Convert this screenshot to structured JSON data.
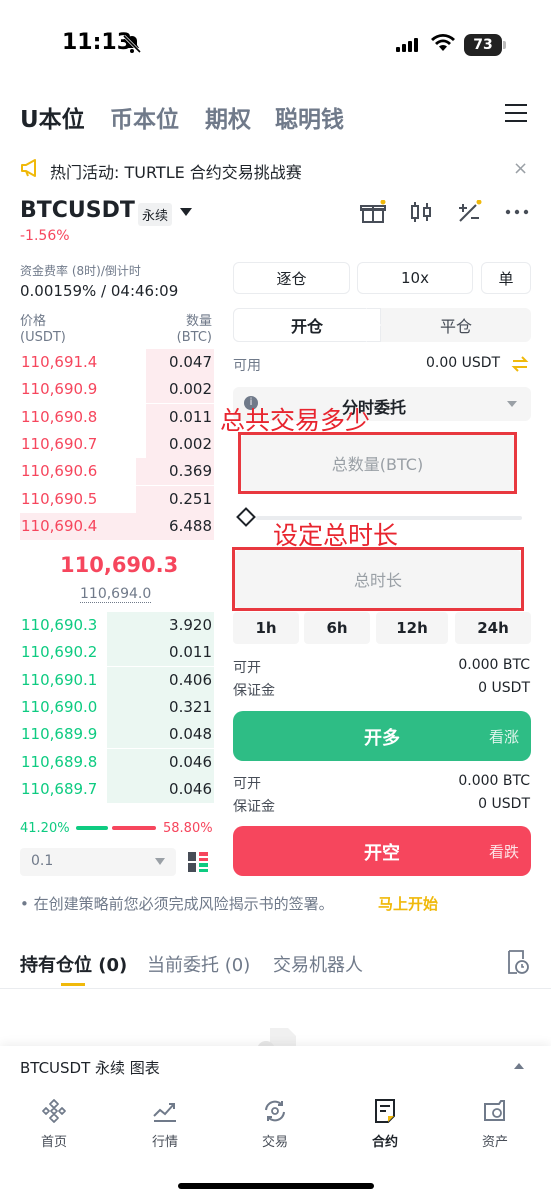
{
  "status_bar": {
    "time": "11:13",
    "battery": "73"
  },
  "top_tabs": [
    "U本位",
    "币本位",
    "期权",
    "聪明钱"
  ],
  "banner": {
    "text": "热门活动: TURTLE 合约交易挑战赛",
    "close": "×"
  },
  "symbol": {
    "name": "BTCUSDT",
    "tag": "永续",
    "change": "-1.56%"
  },
  "funding": {
    "label": "资金费率 (8时)/倒计时",
    "value": "0.00159% / 04:46:09"
  },
  "orderbook": {
    "price_header": "价格",
    "price_unit": "(USDT)",
    "qty_header": "数量",
    "qty_unit": "(BTC)",
    "asks": [
      {
        "price": "110,691.4",
        "qty": "0.047",
        "depth": 0.35
      },
      {
        "price": "110,690.9",
        "qty": "0.002",
        "depth": 0.35
      },
      {
        "price": "110,690.8",
        "qty": "0.011",
        "depth": 0.35
      },
      {
        "price": "110,690.7",
        "qty": "0.002",
        "depth": 0.35
      },
      {
        "price": "110,690.6",
        "qty": "0.369",
        "depth": 0.4
      },
      {
        "price": "110,690.5",
        "qty": "0.251",
        "depth": 0.4
      },
      {
        "price": "110,690.4",
        "qty": "6.488",
        "depth": 1.0
      }
    ],
    "last_price": "110,690.3",
    "mark_price": "110,694.0",
    "bids": [
      {
        "price": "110,690.3",
        "qty": "3.920",
        "depth": 0.55
      },
      {
        "price": "110,690.2",
        "qty": "0.011",
        "depth": 0.55
      },
      {
        "price": "110,690.1",
        "qty": "0.406",
        "depth": 0.55
      },
      {
        "price": "110,690.0",
        "qty": "0.321",
        "depth": 0.55
      },
      {
        "price": "110,689.9",
        "qty": "0.048",
        "depth": 0.55
      },
      {
        "price": "110,689.8",
        "qty": "0.046",
        "depth": 0.55
      },
      {
        "price": "110,689.7",
        "qty": "0.046",
        "depth": 0.55
      }
    ],
    "buy_ratio": "41.20%",
    "sell_ratio": "58.80%",
    "precision": "0.1"
  },
  "order_panel": {
    "margin_mode": "逐仓",
    "leverage": "10x",
    "position_mode": "单",
    "open_tab": "开仓",
    "close_tab": "平仓",
    "available_label": "可用",
    "available_value": "0.00 USDT",
    "order_type": "分时委托",
    "annotation_1": "总共交易多少",
    "quantity_placeholder": "总数量(BTC)",
    "annotation_2": "设定总时长",
    "duration_placeholder": "总时长",
    "durations": [
      "1h",
      "6h",
      "12h",
      "24h"
    ],
    "long_open_label": "可开",
    "long_open_value": "0.000 BTC",
    "long_margin_label": "保证金",
    "long_margin_value": "0 USDT",
    "long_button": "开多",
    "long_sub": "看涨",
    "short_open_label": "可开",
    "short_open_value": "0.000 BTC",
    "short_margin_label": "保证金",
    "short_margin_value": "0 USDT",
    "short_button": "开空",
    "short_sub": "看跌"
  },
  "notice": {
    "text": "•  在创建策略前您必须完成风险揭示书的签署。",
    "link": "马上开始"
  },
  "position_tabs": [
    "持有仓位 (0)",
    "当前委托 (0)",
    "交易机器人"
  ],
  "chart_bar": {
    "label": "BTCUSDT 永续  图表"
  },
  "bottom_nav": [
    "首页",
    "行情",
    "交易",
    "合约",
    "资产"
  ],
  "colors": {
    "green": "#2ebd85",
    "red": "#f6465d",
    "yellow": "#f0b90b",
    "annotation": "#e8252f"
  }
}
